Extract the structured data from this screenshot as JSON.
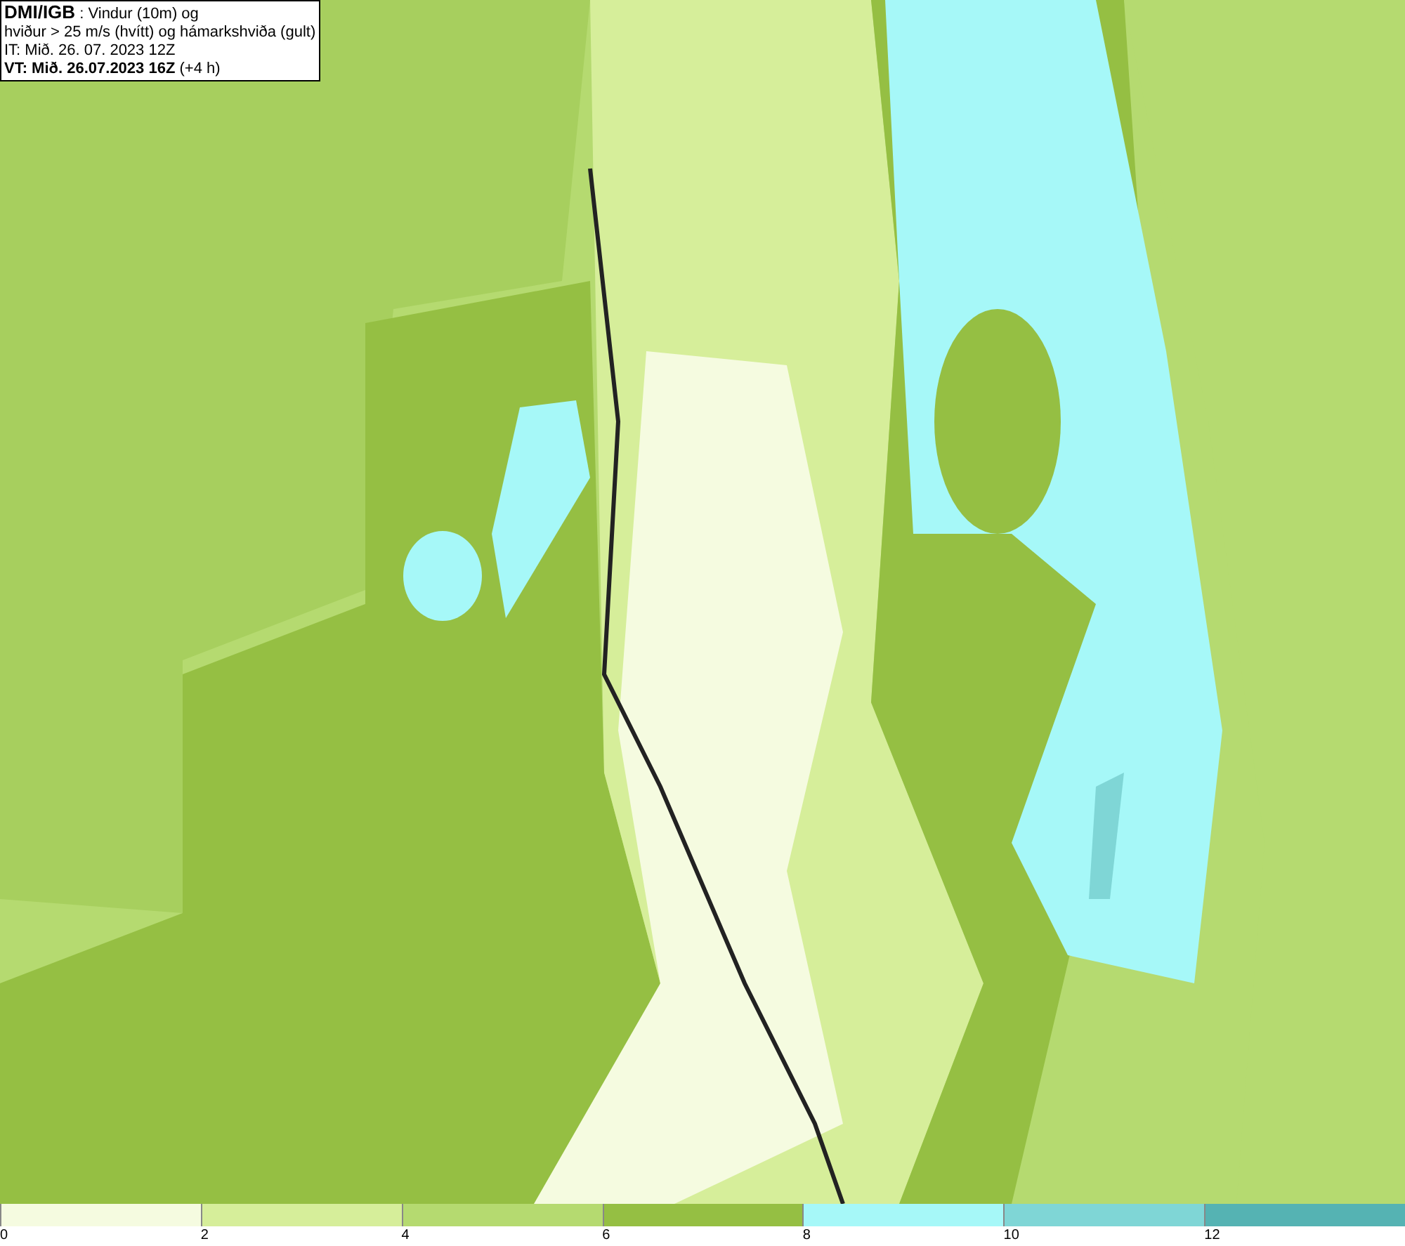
{
  "header": {
    "source": "DMI/IGB",
    "title": ": Vindur (10m) og",
    "subtitle": "hviður > 25 m/s (hvítt) og hámarkshviða (gult)",
    "initial_time": "IT: Mið. 26. 07. 2023 12Z",
    "valid_time": "VT: Mið. 26.07.2023 16Z",
    "offset": "(+4 h)"
  },
  "legend": [
    {
      "label": "0",
      "color": "#f5fbe0"
    },
    {
      "label": "2",
      "color": "#d6ee9a"
    },
    {
      "label": "4",
      "color": "#b5da70"
    },
    {
      "label": "6",
      "color": "#95bf43"
    },
    {
      "label": "8",
      "color": "#a6f8f8"
    },
    {
      "label": "10",
      "color": "#7fd6d6"
    },
    {
      "label": "12",
      "color": "#55b3b3"
    }
  ]
}
